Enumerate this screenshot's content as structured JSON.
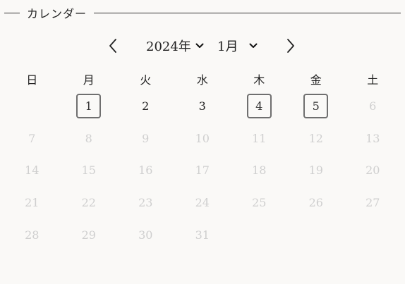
{
  "header": {
    "title": "カレンダー"
  },
  "nav": {
    "year": "2024年",
    "month": "1月"
  },
  "icons": {
    "prev": "chevron-left-icon",
    "next": "chevron-right-icon",
    "dropdown": "chevron-down-icon"
  },
  "weekdays": [
    "日",
    "月",
    "火",
    "水",
    "木",
    "金",
    "土"
  ],
  "weeks": [
    [
      {
        "label": "",
        "state": "empty"
      },
      {
        "label": "1",
        "state": "boxed"
      },
      {
        "label": "2",
        "state": "normal"
      },
      {
        "label": "3",
        "state": "normal"
      },
      {
        "label": "4",
        "state": "boxed"
      },
      {
        "label": "5",
        "state": "boxed"
      },
      {
        "label": "6",
        "state": "muted"
      }
    ],
    [
      {
        "label": "7",
        "state": "muted"
      },
      {
        "label": "8",
        "state": "muted"
      },
      {
        "label": "9",
        "state": "muted"
      },
      {
        "label": "10",
        "state": "muted"
      },
      {
        "label": "11",
        "state": "muted"
      },
      {
        "label": "12",
        "state": "muted"
      },
      {
        "label": "13",
        "state": "muted"
      }
    ],
    [
      {
        "label": "14",
        "state": "muted"
      },
      {
        "label": "15",
        "state": "muted"
      },
      {
        "label": "16",
        "state": "muted"
      },
      {
        "label": "17",
        "state": "muted"
      },
      {
        "label": "18",
        "state": "muted"
      },
      {
        "label": "19",
        "state": "muted"
      },
      {
        "label": "20",
        "state": "muted"
      }
    ],
    [
      {
        "label": "21",
        "state": "muted"
      },
      {
        "label": "22",
        "state": "muted"
      },
      {
        "label": "23",
        "state": "muted"
      },
      {
        "label": "24",
        "state": "muted"
      },
      {
        "label": "25",
        "state": "muted"
      },
      {
        "label": "26",
        "state": "muted"
      },
      {
        "label": "27",
        "state": "muted"
      }
    ],
    [
      {
        "label": "28",
        "state": "muted"
      },
      {
        "label": "29",
        "state": "muted"
      },
      {
        "label": "30",
        "state": "muted"
      },
      {
        "label": "31",
        "state": "muted"
      },
      {
        "label": "",
        "state": "empty"
      },
      {
        "label": "",
        "state": "empty"
      },
      {
        "label": "",
        "state": "empty"
      }
    ]
  ]
}
